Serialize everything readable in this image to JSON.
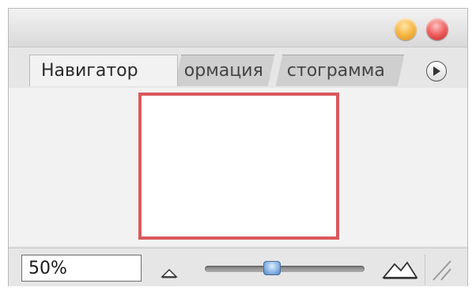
{
  "panel": {
    "window_controls": {
      "minimize_icon": "yellow-circle",
      "close_icon": "red-circle"
    },
    "tabs": [
      {
        "label": "Навигатор",
        "active": true
      },
      {
        "label": "ормация",
        "active": false
      },
      {
        "label": "стограмма",
        "active": false
      }
    ],
    "menu_icon": "play-triangle-circle",
    "zoom": {
      "value": "50%",
      "slider_level": 0.45
    },
    "colors": {
      "viewbox": "#d9595d",
      "slider_thumb": "#8cb6e6"
    }
  }
}
